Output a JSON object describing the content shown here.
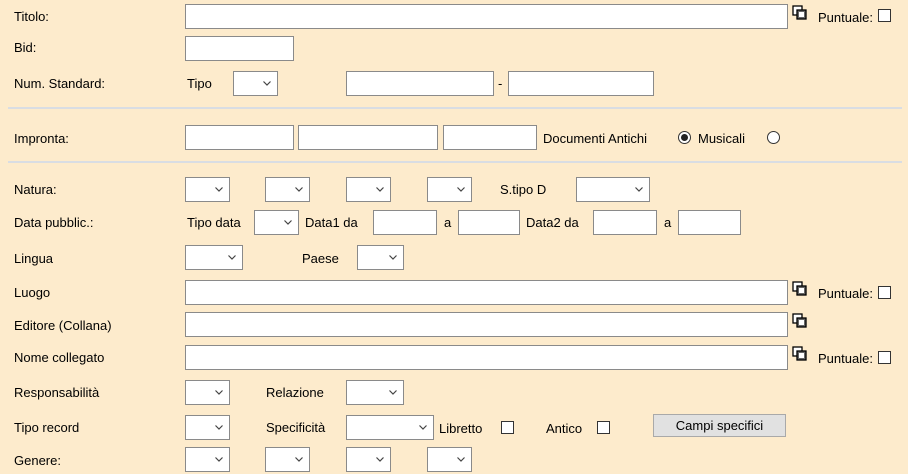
{
  "labels": {
    "titolo": "Titolo:",
    "bid": "Bid:",
    "num_standard": "Num. Standard:",
    "tipo": "Tipo",
    "dash": "-",
    "impronta": "Impronta:",
    "documenti_antichi": "Documenti Antichi",
    "musicali": "Musicali",
    "natura": "Natura:",
    "stipo_d": "S.tipo D",
    "data_pubblic": "Data pubblic.:",
    "tipo_data": "Tipo data",
    "data1_da": "Data1 da",
    "a1": "a",
    "data2_da": "Data2 da",
    "a2": "a",
    "lingua": "Lingua",
    "paese": "Paese",
    "luogo": "Luogo",
    "editore_collana": "Editore (Collana)",
    "nome_collegato": "Nome collegato",
    "responsabilita": "Responsabilità",
    "relazione": "Relazione",
    "tipo_record": "Tipo record",
    "specificita": "Specificità",
    "libretto": "Libretto",
    "antico": "Antico",
    "genere": "Genere:",
    "puntuale_titolo": "Puntuale:",
    "puntuale_luogo": "Puntuale:",
    "puntuale_nome": "Puntuale:"
  },
  "buttons": {
    "campi_specifici": "Campi specifici"
  },
  "radios": {
    "documenti_antichi_selected": true,
    "musicali_selected": false
  },
  "icons": {
    "copy": "copy-icon",
    "chevron": "chevron-down-icon"
  }
}
